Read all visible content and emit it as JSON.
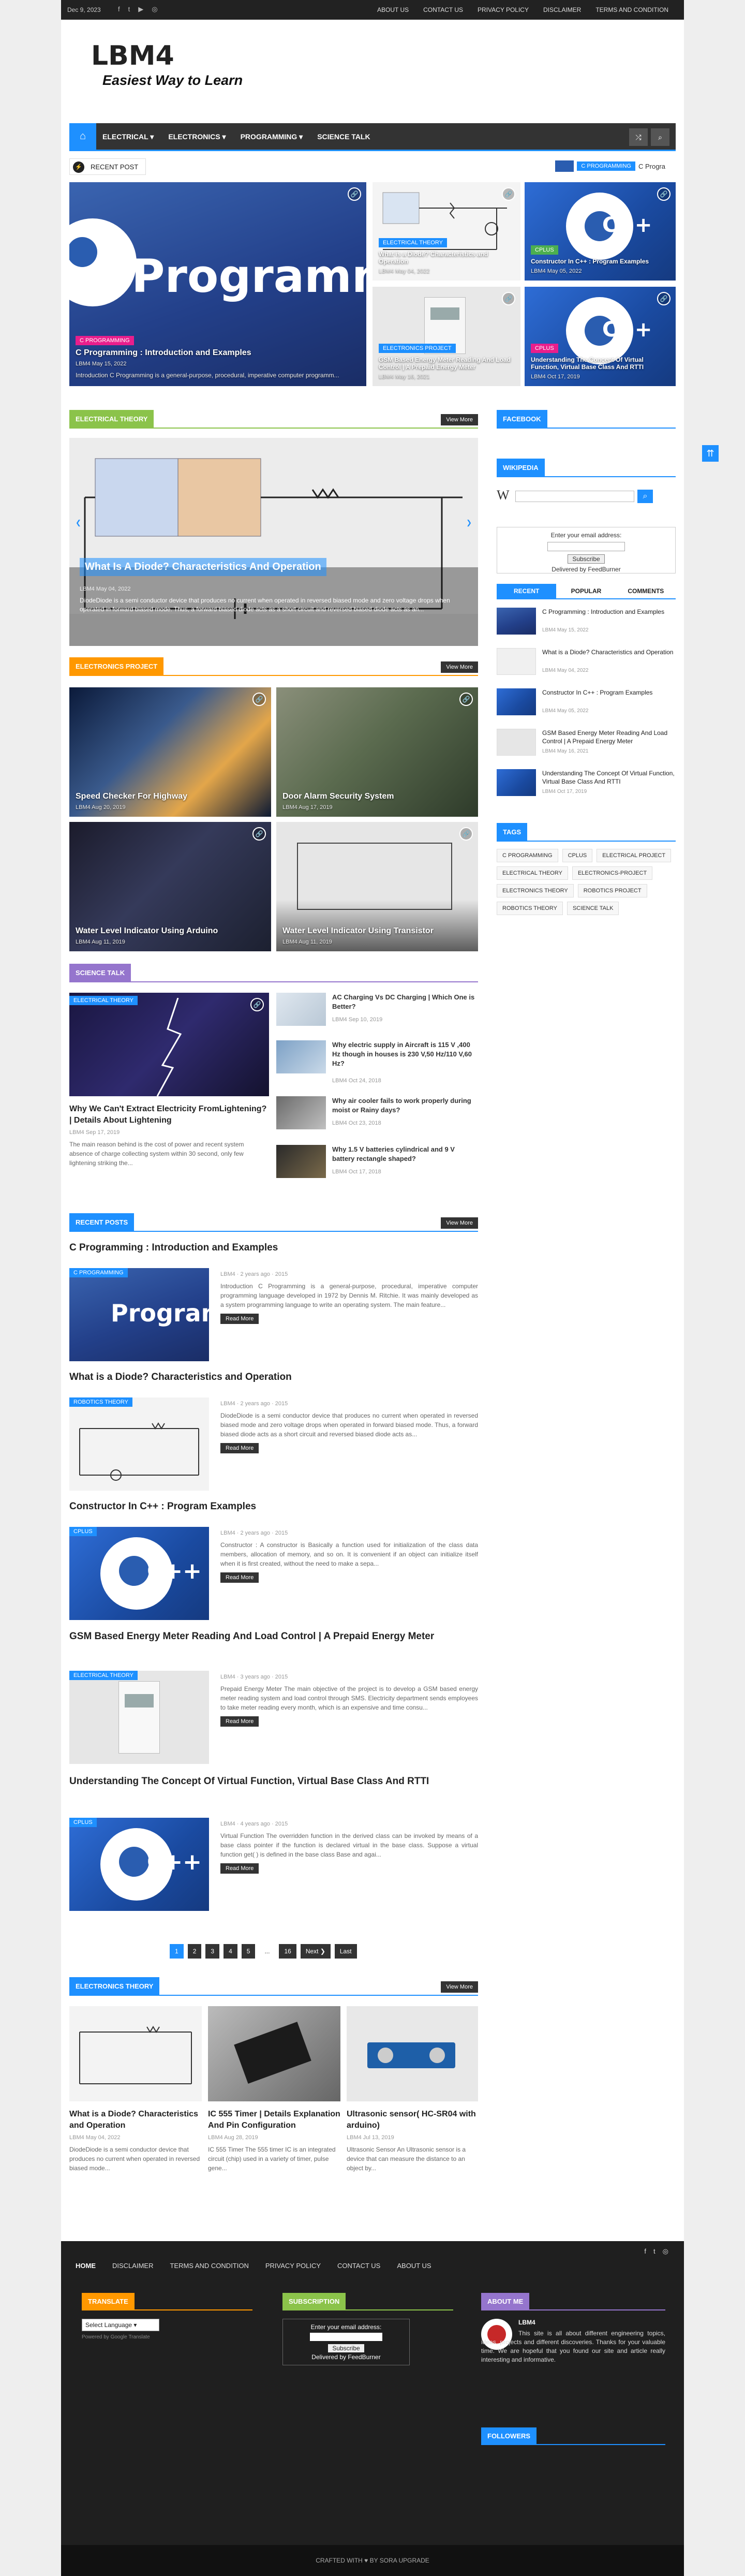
{
  "topbar": {
    "date": "Dec 9, 2023",
    "links": [
      "ABOUT US",
      "CONTACT US",
      "PRIVACY POLICY",
      "DISCLAIMER",
      "TERMS AND CONDITION"
    ]
  },
  "brand": {
    "logo": "LBM4",
    "tagline": "Easiest Way to Learn"
  },
  "nav": {
    "items": [
      "ELECTRICAL ▾",
      "ELECTRONICS ▾",
      "PROGRAMMING ▾",
      "SCIENCE TALK"
    ]
  },
  "recent": {
    "label": "RECENT POST",
    "ticker_tag": "C PROGRAMMING",
    "ticker_text": "C Progra"
  },
  "hero": {
    "main": {
      "tag": "C PROGRAMMING",
      "title": "C Programming : Introduction and Examples",
      "meta": "LBM4  May 15, 2022",
      "snippet": "Introduction C Programming is a general-purpose, procedural, imperative computer programm...",
      "bgword": "Programmi"
    },
    "t1": {
      "tag": "ELECTRICAL THEORY",
      "title": "What is a Diode? Characteristics and Operation",
      "meta": "LBM4  May 04, 2022"
    },
    "t2": {
      "tag": "CPLUS",
      "title": "Constructor In C++ : Program Examples",
      "meta": "LBM4  May 05, 2022"
    },
    "b1": {
      "tag": "ELECTRONICS PROJECT",
      "title": "GSM Based Energy Meter Reading And Load Control | A Prepaid Energy Meter",
      "meta": "LBM4  May 16, 2021"
    },
    "b2": {
      "tag": "CPLUS",
      "title": "Understanding The Concept Of Virtual Function, Virtual Base Class And RTTI",
      "meta": "LBM4  Oct 17, 2019"
    }
  },
  "sections": {
    "electrical_theory": {
      "label": "ELECTRICAL THEORY",
      "more": "View More",
      "title": "What Is A Diode? Characteristics And Operation",
      "meta": "LBM4  May 04, 2022",
      "snippet": "DiodeDiode is a semi conductor device that produces no current when operated in reversed biased mode and zero voltage drops when operated in forward biased mode. Thus, a forward biased diode acts as a short circuit and reversed biased diode acts as an..."
    },
    "electronics_project": {
      "label": "ELECTRONICS PROJECT",
      "more": "View More",
      "items": [
        {
          "title": "Speed Checker For Highway",
          "meta": "LBM4  Aug 20, 2019"
        },
        {
          "title": "Door Alarm Security System",
          "meta": "LBM4  Aug 17, 2019"
        },
        {
          "title": "Water Level Indicator Using Arduino",
          "meta": "LBM4  Aug 11, 2019"
        },
        {
          "title": "Water Level Indicator Using Transistor",
          "meta": "LBM4  Aug 11, 2019"
        }
      ]
    },
    "science_talk": {
      "label": "SCIENCE TALK",
      "main": {
        "tag": "ELECTRICAL THEORY",
        "title": "Why We Can't Extract Electricity FromLightening? | Details About Lightening",
        "meta": "LBM4  Sep 17, 2019",
        "snippet": "The main reason behind is the cost of power and recent system absence of charge collecting system within 30 second, only few lightening striking the..."
      },
      "list": [
        {
          "title": "AC Charging Vs DC Charging | Which One is Better?",
          "meta": "LBM4  Sep 10, 2019"
        },
        {
          "title": "Why electric supply in Aircraft is 115 V ,400 Hz though in houses is 230 V,50 Hz/110 V,60 Hz?",
          "meta": "LBM4  Oct 24, 2018"
        },
        {
          "title": "Why air cooler fails to work properly during moist or Rainy days?",
          "meta": "LBM4  Oct 23, 2018"
        },
        {
          "title": "Why 1.5 V batteries cylindrical and 9 V battery rectangle shaped?",
          "meta": "LBM4  Oct 17, 2018"
        }
      ]
    },
    "recent_posts": {
      "label": "RECENT POSTS",
      "more": "View More",
      "posts": [
        {
          "title": "C Programming : Introduction and Examples",
          "tag": "C PROGRAMMING",
          "meta": "LBM4  ·  2 years ago  ·  2015",
          "snippet": "Introduction C Programming is a general-purpose, procedural, imperative computer programming language developed in 1972 by Dennis M. Ritchie. It was mainly developed as a system programming language to write an operating system. The main feature...",
          "more": "Read More"
        },
        {
          "title": "What is a Diode? Characteristics and Operation",
          "tag": "ROBOTICS THEORY",
          "meta": "LBM4  ·  2 years ago  ·  2015",
          "snippet": "DiodeDiode is a semi conductor device that produces no current when operated in reversed biased mode and zero voltage drops when operated in forward biased mode. Thus, a forward biased diode acts as a short circuit and reversed biased diode acts as...",
          "more": "Read More"
        },
        {
          "title": "Constructor In C++ : Program Examples",
          "tag": "CPLUS",
          "meta": "LBM4  ·  2 years ago  ·  2015",
          "snippet": "Constructor : A constructor is Basically a function used for initialization of the class data members, allocation of memory, and so on. It is convenient if an object can initialize itself when it is first created, without the need to make a sepa...",
          "more": "Read More"
        },
        {
          "title": "GSM Based Energy Meter Reading And Load Control | A Prepaid Energy Meter",
          "tag": "ELECTRICAL THEORY",
          "meta": "LBM4  ·  3 years ago  ·  2015",
          "snippet": "Prepaid Energy Meter The main objective of the project is to develop a GSM based energy meter reading system and load control through SMS. Electricity department sends employees to take meter reading every month, which is an expensive and time consu...",
          "more": "Read More"
        },
        {
          "title": "Understanding The Concept Of Virtual Function, Virtual Base Class And RTTI",
          "tag": "CPLUS",
          "meta": "LBM4  ·  4 years ago  ·  2015",
          "snippet": "Virtual Function The overridden function in the derived class can be invoked by means of a base class pointer if the function is declared virtual in the base class. Suppose a virtual function get( ) is defined in the base class Base and agai...",
          "more": "Read More"
        }
      ],
      "pager": [
        "1",
        "2",
        "3",
        "4",
        "5",
        "...",
        "16",
        "Next ❯",
        "Last"
      ]
    },
    "electronics_theory": {
      "label": "ELECTRONICS THEORY",
      "more": "View More",
      "items": [
        {
          "title": "What is a Diode? Characteristics and Operation",
          "meta": "LBM4  May 04, 2022",
          "snippet": "DiodeDiode is a semi conductor device that produces no current when operated in reversed biased mode..."
        },
        {
          "title": "IC 555 Timer | Details Explanation And Pin Configuration",
          "meta": "LBM4  Aug 28, 2019",
          "snippet": "IC 555 Timer The 555 timer IC is an integrated circuit (chip) used in a variety of timer, pulse gene..."
        },
        {
          "title": "Ultrasonic sensor( HC-SR04 with arduino)",
          "meta": "LBM4  Jul 13, 2019",
          "snippet": "Ultrasonic Sensor An Ultrasonic sensor is a device that can measure the distance to an object by..."
        }
      ]
    }
  },
  "sidebar": {
    "facebook": "FACEBOOK",
    "wikipedia": "WIKIPEDIA",
    "subscribe": {
      "label": "Enter your email address:",
      "button": "Subscribe",
      "delivered": "Delivered by FeedBurner"
    },
    "tabs": [
      "RECENT",
      "POPULAR",
      "COMMENTS"
    ],
    "recent": [
      {
        "title": "C Programming : Introduction and Examples",
        "meta": "LBM4  May 15, 2022"
      },
      {
        "title": "What is a Diode? Characteristics and Operation",
        "meta": "LBM4  May 04, 2022"
      },
      {
        "title": "Constructor In C++ : Program Examples",
        "meta": "LBM4  May 05, 2022"
      },
      {
        "title": "GSM Based Energy Meter Reading And Load Control | A Prepaid Energy Meter",
        "meta": "LBM4  May 16, 2021"
      },
      {
        "title": "Understanding The Concept Of Virtual Function, Virtual Base Class And RTTI",
        "meta": "LBM4  Oct 17, 2019"
      }
    ],
    "tags_label": "TAGS",
    "tags": [
      "C PROGRAMMING",
      "CPLUS",
      "ELECTRICAL PROJECT",
      "ELECTRICAL THEORY",
      "ELECTRONICS-PROJECT",
      "ELECTRONICS THEORY",
      "ROBOTICS PROJECT",
      "ROBOTICS THEORY",
      "SCIENCE TALK"
    ]
  },
  "footer": {
    "nav": [
      "HOME",
      "DISCLAIMER",
      "TERMS AND CONDITION",
      "PRIVACY POLICY",
      "CONTACT US",
      "ABOUT US"
    ],
    "translate": "TRANSLATE",
    "select_language": "Select Language",
    "powered": "Powered by Google Translate",
    "subscription": "SUBSCRIPTION",
    "sub_label": "Enter your email address:",
    "sub_button": "Subscribe",
    "sub_delivered": "Delivered by FeedBurner",
    "about": "ABOUT ME",
    "about_name": "LBM4",
    "about_text": "This site is all about different engineering topics, ideas, projects and different discoveries. Thanks for your valuable time. We are hopeful that you found our site and article really interesting and informative.",
    "followers": "FOLLOWERS",
    "copyright": "CRAFTED WITH ♥ BY SORA UPGRADE"
  },
  "colors": {
    "accent": "#1e90ff",
    "green": "#8bc34a",
    "orange": "#ff9800",
    "purple": "#9575cd"
  }
}
